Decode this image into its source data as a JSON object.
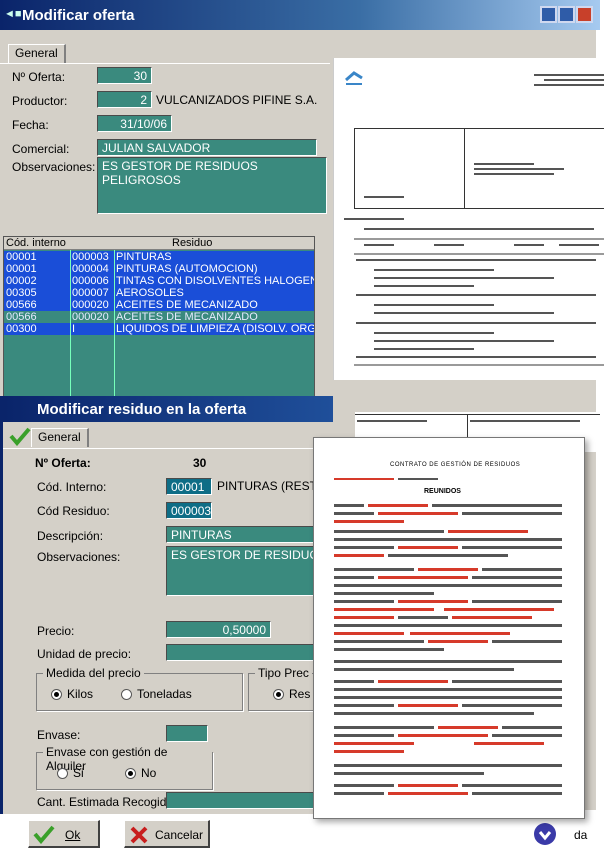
{
  "main_window": {
    "title": "Modificar oferta",
    "tab": "General",
    "labels": {
      "oferta": "Nº Oferta:",
      "productor": "Productor:",
      "fecha": "Fecha:",
      "comercial": "Comercial:",
      "observaciones": "Observaciones:"
    },
    "values": {
      "oferta": "30",
      "productor_num": "2",
      "productor_name": "VULCANIZADOS PIFINE S.A.",
      "fecha": "31/10/06",
      "comercial": "JULIAN SALVADOR",
      "observaciones": "ES GESTOR DE RESIDUOS PELIGROSOS"
    },
    "grid": {
      "headers": [
        "Cód. interno",
        "Residuo"
      ],
      "rows": [
        {
          "c1": "00001",
          "c2": "000003",
          "c3": "PINTURAS"
        },
        {
          "c1": "00001",
          "c2": "000004",
          "c3": "PINTURAS (AUTOMOCION)"
        },
        {
          "c1": "00002",
          "c2": "000006",
          "c3": "TINTAS CON DISOLVENTES HALOGENAD"
        },
        {
          "c1": "00305",
          "c2": "000007",
          "c3": "AEROSOLES"
        },
        {
          "c1": "00566",
          "c2": "000020",
          "c3": "ACEITES DE MECANIZADO"
        },
        {
          "c1": "00566",
          "c2": "000020",
          "c3": "ACEITES DE MECANIZADO"
        },
        {
          "c1": "00300",
          "c2": "I",
          "c3": "LIQUIDOS DE LIMPIEZA (DISOLV. ORG. N"
        }
      ]
    }
  },
  "residue_window": {
    "title": "Modificar residuo en la oferta",
    "tab": "General",
    "labels": {
      "oferta": "Nº Oferta:",
      "cod_interno": "Cód. Interno:",
      "cod_residuo": "Cód Residuo:",
      "descripcion": "Descripción:",
      "observaciones": "Observaciones:",
      "precio": "Precio:",
      "unidad": "Unidad de precio:",
      "medida": "Medida del precio",
      "tipo": "Tipo Prec",
      "envase": "Envase:",
      "envase_alquiler": "Envase con gestión de Alquiler",
      "cantidad": "Cant. Estimada Recogida:"
    },
    "values": {
      "oferta": "30",
      "cod_interno": "00001",
      "cod_interno_text": "PINTURAS (REST",
      "cod_residuo": "000003",
      "descripcion": "PINTURAS",
      "observaciones": "ES GESTOR DE RESIDUOS",
      "precio": "0,50000"
    },
    "radios": {
      "kilos": "Kilos",
      "toneladas": "Toneladas",
      "res": "Res",
      "si": "Si",
      "no": "No"
    },
    "buttons": {
      "ok": "Ok",
      "cancelar": "Cancelar",
      "ayuda_partial": "da"
    }
  },
  "document": {
    "heading": "CONTRATO DE GESTIÓN DE RESIDUOS",
    "reunidos": "REUNIDOS"
  },
  "colors": {
    "title_bar": "#0a246a",
    "field_bg": "#3a8a7e",
    "selected_row": "#1a4ed8",
    "doc_red": "#d63a2a"
  }
}
